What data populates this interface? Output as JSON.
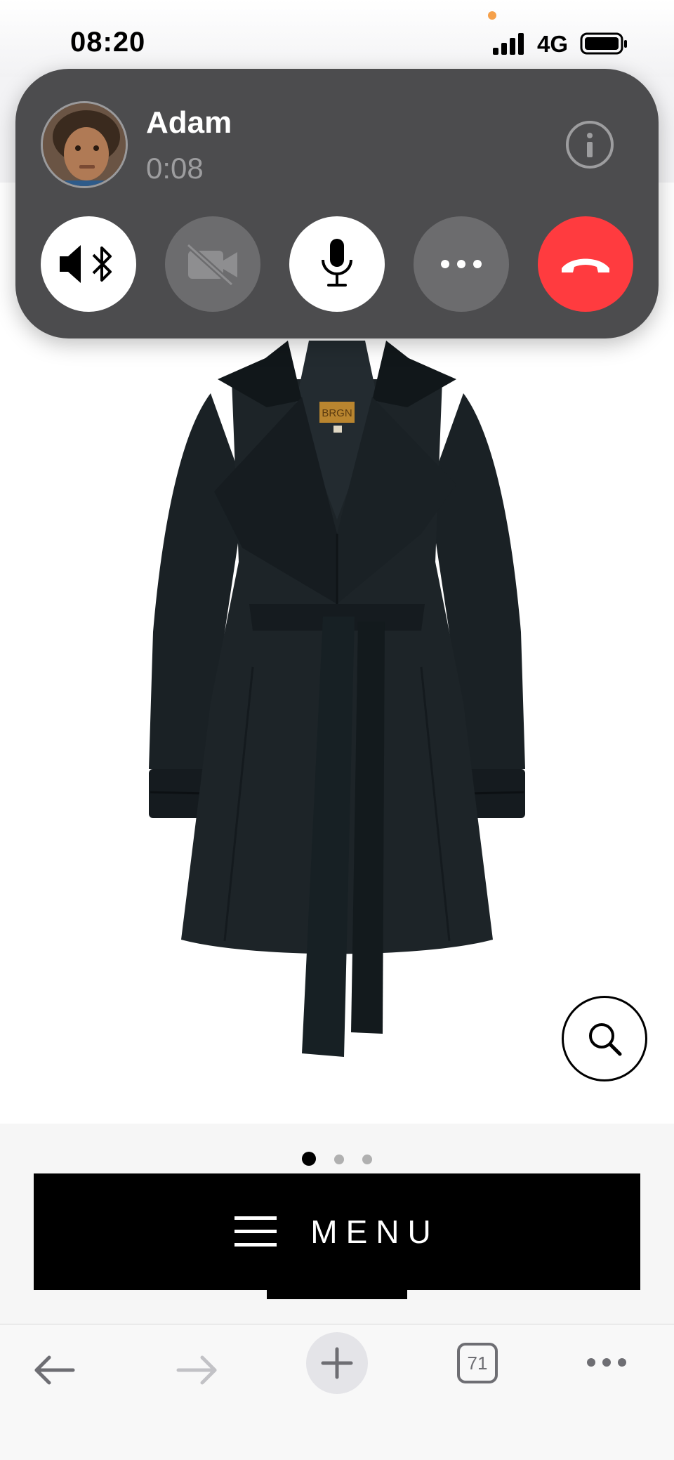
{
  "status_bar": {
    "time": "08:20",
    "network": "4G"
  },
  "call": {
    "caller_name": "Adam",
    "duration": "0:08",
    "buttons": [
      "speaker-bluetooth",
      "camera-off",
      "microphone",
      "more",
      "end-call"
    ]
  },
  "product": {
    "label_text": "BRGN",
    "image_indicator": {
      "total": 3,
      "active": 1
    }
  },
  "menu": {
    "label": "MENU"
  },
  "browser_toolbar": {
    "tab_count": "71"
  },
  "colors": {
    "end_call": "#ff3b3f",
    "call_banner": "#4c4c4e",
    "menu_bar": "#000000",
    "coat": "#1b2226"
  }
}
